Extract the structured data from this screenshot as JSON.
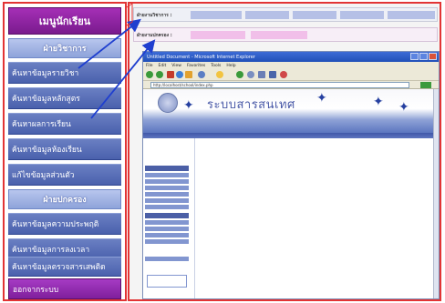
{
  "menu": {
    "header": "เมนูนักเรียน",
    "section_academic": "ฝ่ายวิชาการ",
    "academic_items": [
      {
        "label": "ค้นหาข้อมูลรายวิชา"
      },
      {
        "label": "ค้นหาข้อมูลหลักสูตร"
      },
      {
        "label": "ค้นหาผลการเรียน"
      },
      {
        "label": "ค้นหาข้อมูลห้องเรียน"
      },
      {
        "label": "แก้ไขข้อมูลส่วนตัว"
      }
    ],
    "section_governance": "ฝ่ายปกครอง",
    "governance_items": [
      {
        "label": "ค้นหาข้อมูลความประพฤติ"
      },
      {
        "label": "ค้นหาข้อมูลการลงเวลา"
      },
      {
        "label": "ค้นหาข้อมูลตรวจสารเสพติด"
      }
    ],
    "logout": "ออกจากระบบ"
  },
  "screenshot": {
    "topbar_label": "ฝ่ายงานวิชาการ :",
    "topbar_tabs": [
      "",
      "",
      "",
      "",
      ""
    ],
    "subbar_label": "ฝ่ายงานปกครอง :",
    "subbar_tabs": [
      "",
      ""
    ],
    "browser": {
      "title": "Untitled Document - Microsoft Internet Explorer",
      "menus": [
        "File",
        "Edit",
        "View",
        "Favorites",
        "Tools",
        "Help"
      ],
      "address": "http://localhost/school/index.php",
      "banner_title": "ระบบสารสนเทศ",
      "banner_subtitle": "",
      "side_heads": [
        "",
        ""
      ],
      "side_items": [
        "",
        "",
        "",
        "",
        "",
        "",
        "",
        "",
        "",
        "",
        ""
      ],
      "side_box": ""
    }
  },
  "colors": {
    "frame_red": "#e23434",
    "menu_purple": "#8a24a0",
    "menu_blue": "#5066b3",
    "section_light_blue": "#a3b4e4",
    "arrow_blue": "#1f3fcf"
  },
  "icons": {
    "browser_back": "back-arrow-icon",
    "browser_forward": "forward-arrow-icon"
  }
}
